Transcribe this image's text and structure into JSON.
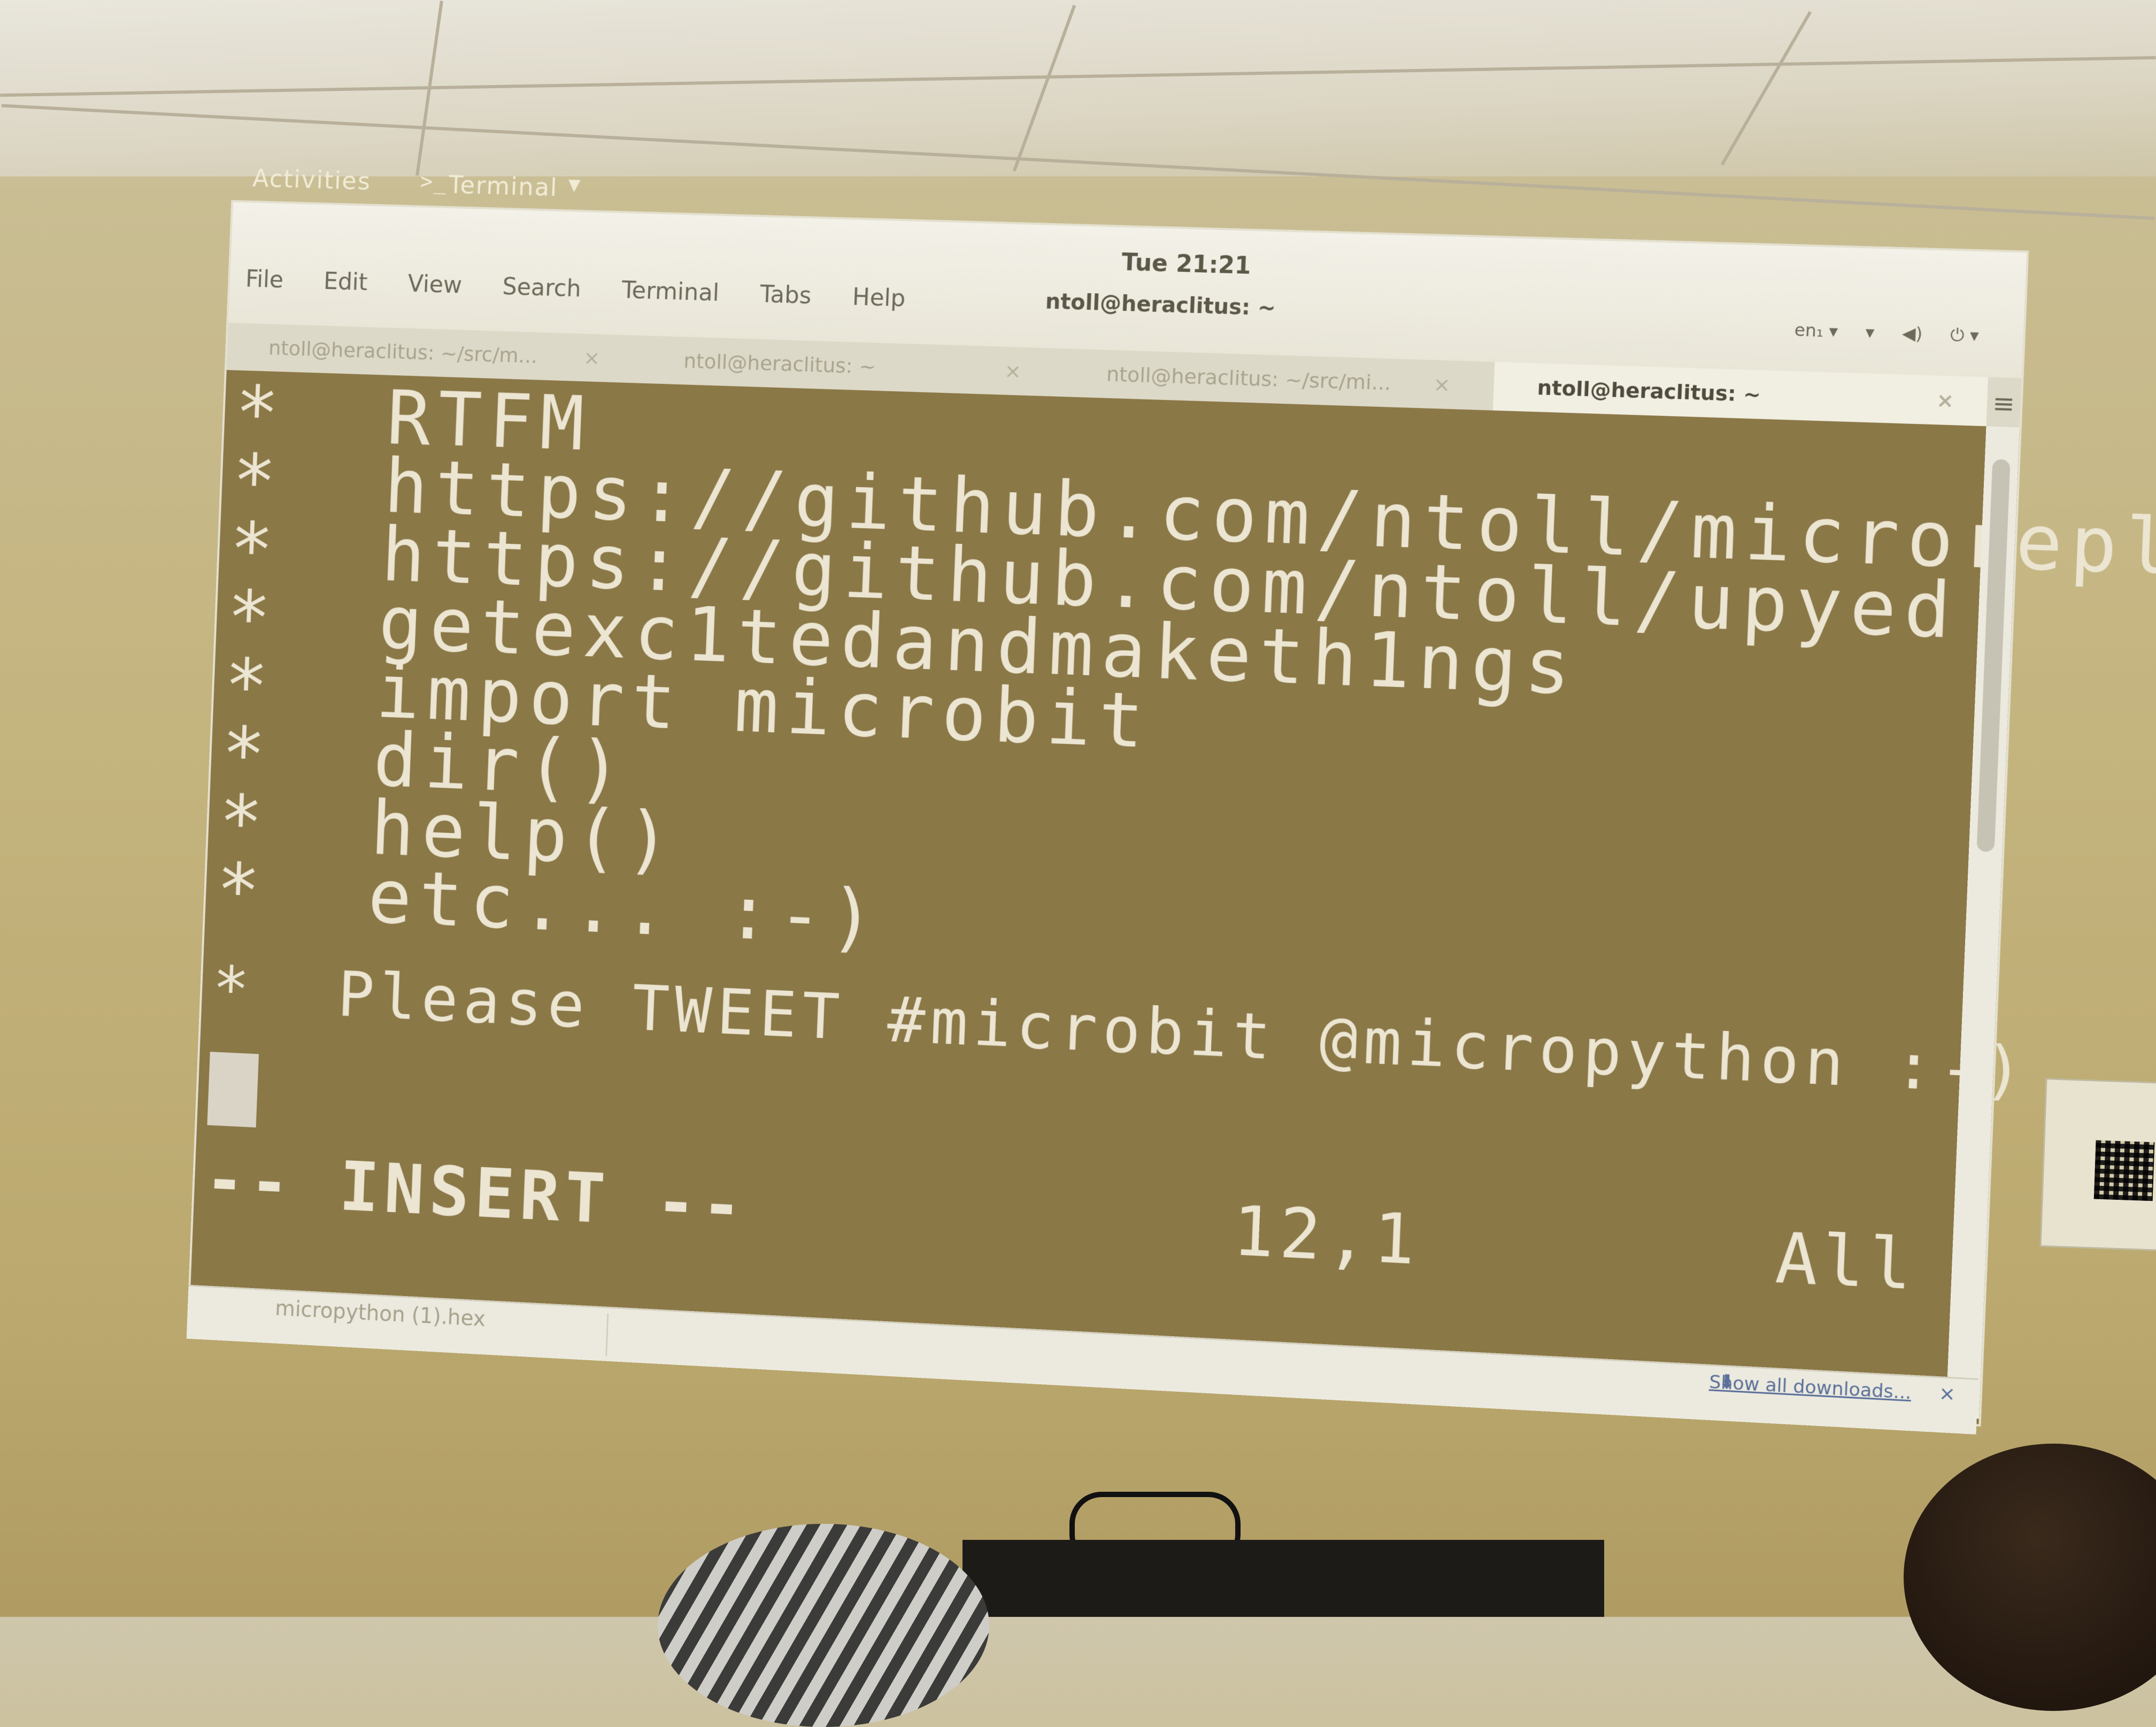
{
  "top_bar": {
    "activities": "Activities",
    "app_name": "Terminal",
    "app_icon": "terminal-icon",
    "clock": "Tue 21:21"
  },
  "window": {
    "title": "ntoll@heraclitus: ~",
    "menu": [
      "File",
      "Edit",
      "View",
      "Search",
      "Terminal",
      "Tabs",
      "Help"
    ],
    "tray": {
      "keyboard": "en₁ ▾",
      "icons": [
        "wifi-icon",
        "volume-icon",
        "power-icon"
      ]
    },
    "tabs": [
      {
        "label": "ntoll@heraclitus: ~/src/m...",
        "active": false
      },
      {
        "label": "ntoll@heraclitus: ~",
        "active": false
      },
      {
        "label": "ntoll@heraclitus: ~/src/mi...",
        "active": false
      },
      {
        "label": "ntoll@heraclitus: ~",
        "active": true
      }
    ]
  },
  "terminal": {
    "lines": [
      "*  RTFM",
      "*  https://github.com/ntoll/microrepl",
      "*  https://github.com/ntoll/upyed",
      "*  getexc1tedandmaketh1ngs",
      "*  import microbit",
      "*  dir()",
      "*  help()",
      "*  etc... :-)",
      "",
      "*  Please TWEET #microbit @micropython :-)"
    ],
    "mode": "-- INSERT --",
    "position": "12,1",
    "scroll": "All"
  },
  "downloads": {
    "item": "micropython (1).hex",
    "show_all": "Show all downloads..."
  },
  "colors": {
    "terminal_bg": "#8b7847",
    "terminal_fg": "#ebe5d2",
    "wall": "#c4b47e"
  }
}
